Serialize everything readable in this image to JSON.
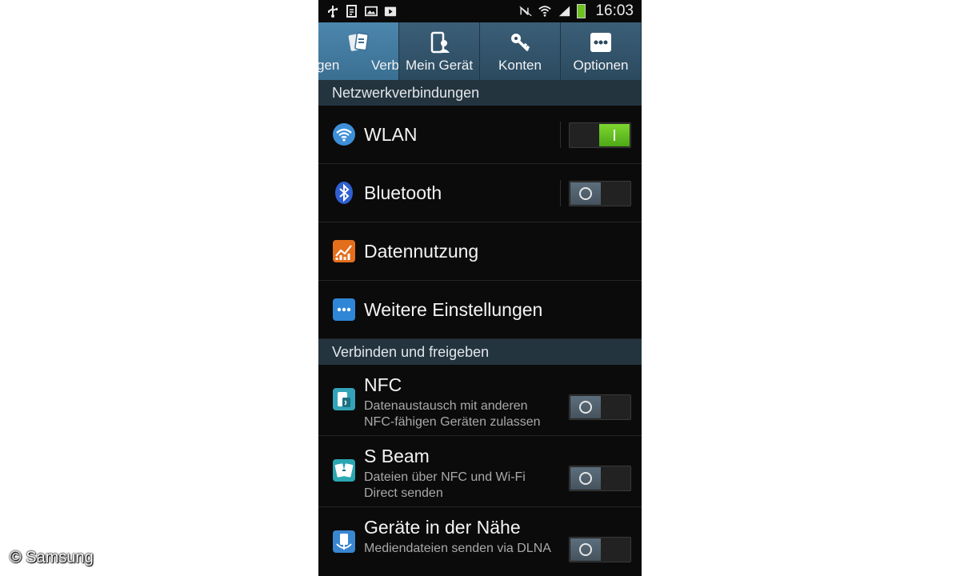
{
  "status_bar": {
    "time": "16:03",
    "left_icons": [
      "usb-icon",
      "clipboard-icon",
      "image-icon",
      "media-icon"
    ],
    "right_icons": [
      "nfc-muted-icon",
      "wifi-icon",
      "signal-icon",
      "battery-icon"
    ],
    "battery_color": "#6ec21f"
  },
  "tabs": [
    {
      "label_part1": "gen",
      "label_part2": "Verb",
      "icon": "connections-tab-icon",
      "active": true
    },
    {
      "label": "Mein Gerät",
      "icon": "device-icon"
    },
    {
      "label": "Konten",
      "icon": "key-icon"
    },
    {
      "label": "Optionen",
      "icon": "more-options-icon"
    }
  ],
  "sections": {
    "network": "Netzwerkverbindungen",
    "connect_share": "Verbinden und freigeben"
  },
  "items": {
    "wlan": {
      "title": "WLAN",
      "toggle": "on"
    },
    "bluetooth": {
      "title": "Bluetooth",
      "toggle": "off"
    },
    "data_usage": {
      "title": "Datennutzung"
    },
    "more_settings": {
      "title": "Weitere Einstellungen"
    },
    "nfc": {
      "title": "NFC",
      "subtitle": "Datenaustausch mit anderen NFC-fähigen Geräten zulassen",
      "toggle": "off"
    },
    "sbeam": {
      "title": "S Beam",
      "subtitle": "Dateien über NFC und Wi-Fi Direct senden",
      "toggle": "off"
    },
    "nearby": {
      "title": "Geräte in der Nähe",
      "subtitle": "Mediendateien senden via DLNA",
      "toggle": "off"
    }
  },
  "colors": {
    "accent_green": "#5cbf1e",
    "section_bg": "#24343f",
    "tab_bg": "#2b4a5f",
    "tab_active_bg": "#3a6f92"
  },
  "watermark": "© Samsung"
}
